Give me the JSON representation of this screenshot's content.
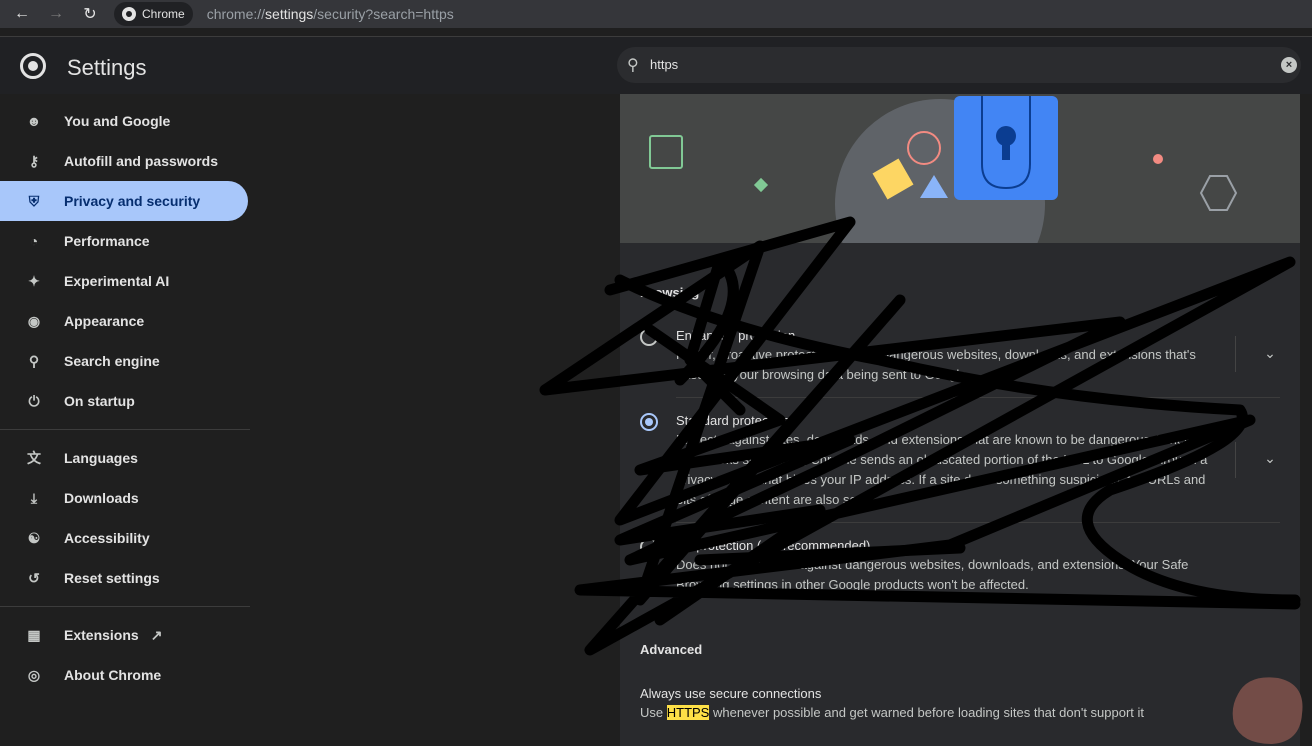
{
  "browser": {
    "chip_label": "Chrome",
    "url_scheme": "chrome://",
    "url_host": "settings",
    "url_path": "/security?search=https"
  },
  "header": {
    "title": "Settings",
    "search_value": "https"
  },
  "sidebar": {
    "items": [
      {
        "label": "You and Google",
        "icon": "person-icon"
      },
      {
        "label": "Autofill and passwords",
        "icon": "key-icon"
      },
      {
        "label": "Privacy and security",
        "icon": "shield-icon",
        "active": true
      },
      {
        "label": "Performance",
        "icon": "speedometer-icon"
      },
      {
        "label": "Experimental AI",
        "icon": "sparkle-icon"
      },
      {
        "label": "Appearance",
        "icon": "palette-icon"
      },
      {
        "label": "Search engine",
        "icon": "search-icon"
      },
      {
        "label": "On startup",
        "icon": "power-icon"
      },
      {
        "label": "Languages",
        "icon": "translate-icon"
      },
      {
        "label": "Downloads",
        "icon": "download-icon"
      },
      {
        "label": "Accessibility",
        "icon": "accessibility-icon"
      },
      {
        "label": "Reset settings",
        "icon": "reset-icon"
      },
      {
        "label": "Extensions",
        "icon": "extension-icon"
      },
      {
        "label": "About Chrome",
        "icon": "chrome-icon"
      }
    ]
  },
  "main": {
    "section_title": "Browsing",
    "options": [
      {
        "title": "Enhanced protection",
        "desc": "Faster, proactive protection against dangerous websites, downloads, and extensions that's based on your browsing data being sent to Google"
      },
      {
        "title": "Standard protection",
        "desc": "Protects against sites, downloads, and extensions that are known to be dangerous. When a page looks suspicious, Chrome sends an obfuscated portion of the URL to Google through a privacy server that hides your IP address. If a site does something suspicious, full URLs and bits of page content are also sent."
      },
      {
        "title": "No protection (not recommended)",
        "desc": "Does not protect you against dangerous websites, downloads, and extensions. Your Safe Browsing settings in other Google products won't be affected."
      }
    ],
    "advanced_title": "Advanced",
    "secure": {
      "title": "Always use secure connections",
      "desc_before": "Use ",
      "desc_highlight": "HTTPS",
      "desc_after": " whenever possible and get warned before loading sites that don't support it"
    }
  },
  "colors": {
    "accent": "#a8c7fa",
    "highlight": "#fde047",
    "banner_lock": "#4285f4"
  }
}
